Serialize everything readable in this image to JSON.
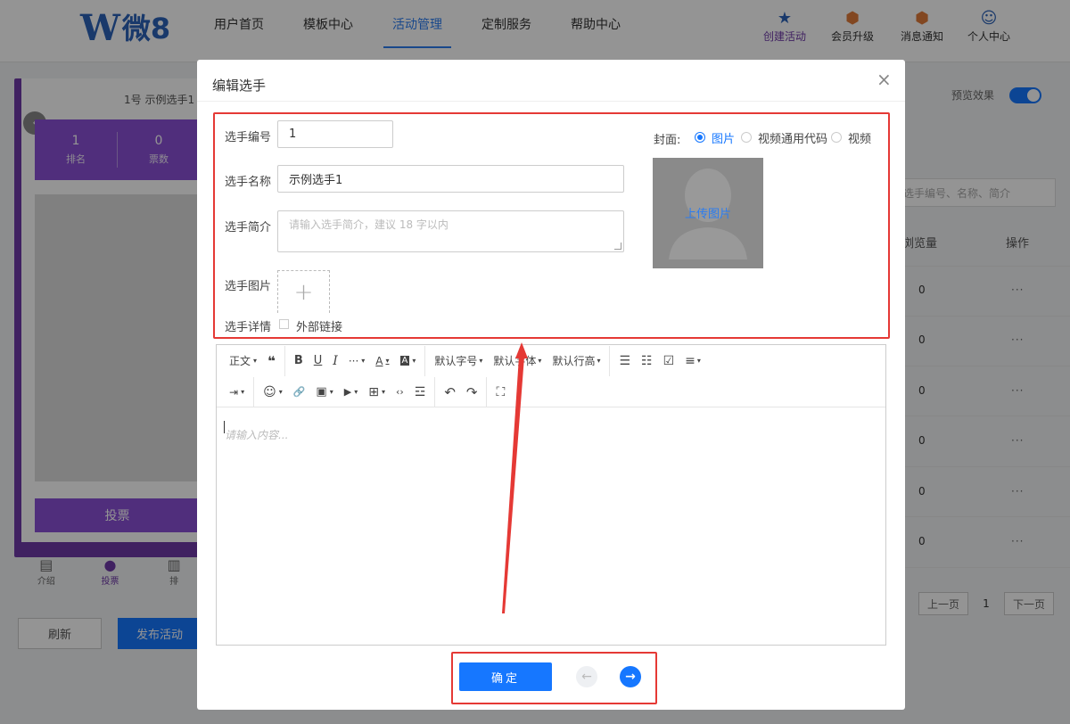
{
  "header": {
    "logo_mark": "W",
    "logo_text": "微8",
    "nav": [
      "用户首页",
      "模板中心",
      "活动管理",
      "定制服务",
      "帮助中心"
    ],
    "active_nav": "活动管理",
    "right": [
      {
        "label": "创建活动",
        "icon": "star-icon"
      },
      {
        "label": "会员升级",
        "icon": "badge-icon"
      },
      {
        "label": "消息通知",
        "icon": "bell-icon"
      },
      {
        "label": "个人中心",
        "icon": "user-icon"
      }
    ]
  },
  "background": {
    "phone_title": "1号 示例选手1",
    "stats": [
      {
        "value": "1",
        "label": "排名"
      },
      {
        "value": "0",
        "label": "票数"
      }
    ],
    "vote_button": "投票",
    "tabs": [
      "介绍",
      "投票",
      "排"
    ],
    "refresh_button": "刷新",
    "publish_button": "发布活动",
    "preview_label": "预览效果",
    "search_placeholder": "选手编号、名称、简介",
    "table_headers": [
      "浏览量",
      "操作"
    ],
    "rows": [
      {
        "views": "0",
        "action": "···"
      },
      {
        "views": "0",
        "action": "···"
      },
      {
        "views": "0",
        "action": "···"
      },
      {
        "views": "0",
        "action": "···"
      },
      {
        "views": "0",
        "action": "···"
      },
      {
        "views": "0",
        "action": "···"
      }
    ],
    "pagination": {
      "prev": "上一页",
      "current": "1",
      "next": "下一页"
    }
  },
  "modal": {
    "title": "编辑选手",
    "form": {
      "number_label": "选手编号",
      "number_value": "1",
      "name_label": "选手名称",
      "name_value": "示例选手1",
      "intro_label": "选手简介",
      "intro_placeholder": "请输入选手简介，建议 18 字以内",
      "image_label": "选手图片",
      "detail_label": "选手详情",
      "external_link_label": "外部链接"
    },
    "cover": {
      "label": "封面:",
      "options": [
        "图片",
        "视频通用代码",
        "视频"
      ],
      "selected": "图片",
      "upload_text": "上传图片"
    },
    "editor": {
      "toolbar_row1": [
        {
          "label": "正文",
          "name": "paragraph-dropdown"
        },
        {
          "label": "❝",
          "name": "quote-icon"
        },
        {
          "label": "B",
          "name": "bold-icon"
        },
        {
          "label": "U",
          "name": "underline-icon"
        },
        {
          "label": "I",
          "name": "italic-icon"
        },
        {
          "label": "···",
          "name": "more-icon"
        },
        {
          "label": "A",
          "name": "font-color-icon"
        },
        {
          "label": "A",
          "name": "bg-color-icon"
        },
        {
          "label": "默认字号",
          "name": "font-size-dropdown"
        },
        {
          "label": "默认字体",
          "name": "font-family-dropdown"
        },
        {
          "label": "默认行高",
          "name": "line-height-dropdown"
        },
        {
          "label": "☰",
          "name": "bullet-list-icon"
        },
        {
          "label": "☷",
          "name": "numbered-list-icon"
        },
        {
          "label": "☑",
          "name": "todo-icon"
        },
        {
          "label": "≡",
          "name": "align-icon"
        }
      ],
      "toolbar_row2": [
        {
          "label": "⇥",
          "name": "indent-icon"
        },
        {
          "label": "☺",
          "name": "emoji-icon"
        },
        {
          "label": "🔗",
          "name": "link-icon"
        },
        {
          "label": "▣",
          "name": "image-icon"
        },
        {
          "label": "▶",
          "name": "video-icon"
        },
        {
          "label": "⊞",
          "name": "table-icon"
        },
        {
          "label": "‹›",
          "name": "code-icon"
        },
        {
          "label": "☲",
          "name": "divider-icon"
        },
        {
          "label": "↶",
          "name": "undo-icon"
        },
        {
          "label": "↷",
          "name": "redo-icon"
        },
        {
          "label": "⛶",
          "name": "fullscreen-icon"
        }
      ],
      "placeholder": "请输入内容..."
    },
    "ok_button": "确定",
    "prev_icon": "←",
    "next_icon": "→",
    "close_icon": "×"
  },
  "colors": {
    "primary": "#1677ff",
    "theme_purple": "#8a50d6",
    "annotation_red": "#e53935"
  }
}
